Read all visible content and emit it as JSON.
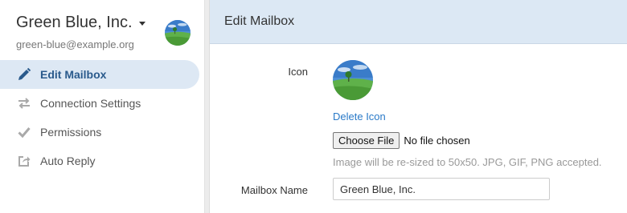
{
  "mailbox": {
    "name": "Green Blue, Inc.",
    "email": "green-blue@example.org"
  },
  "nav": {
    "items": [
      {
        "label": "Edit Mailbox",
        "icon": "pencil-icon",
        "active": true
      },
      {
        "label": "Connection Settings",
        "icon": "arrows-exchange-icon",
        "active": false
      },
      {
        "label": "Permissions",
        "icon": "checkmark-icon",
        "active": false
      },
      {
        "label": "Auto Reply",
        "icon": "reply-share-icon",
        "active": false
      }
    ]
  },
  "main": {
    "title": "Edit Mailbox",
    "icon_label": "Icon",
    "delete_icon_label": "Delete Icon",
    "choose_file_label": "Choose File",
    "no_file_text": "No file chosen",
    "resize_hint": "Image will be re-sized to 50x50. JPG, GIF, PNG accepted.",
    "mailbox_name_label": "Mailbox Name",
    "mailbox_name_value": "Green Blue, Inc."
  },
  "colors": {
    "accent": "#2a5a8c",
    "link": "#2a7ac8",
    "active_nav_bg": "#dde8f4",
    "header_bg": "#dce8f4"
  }
}
